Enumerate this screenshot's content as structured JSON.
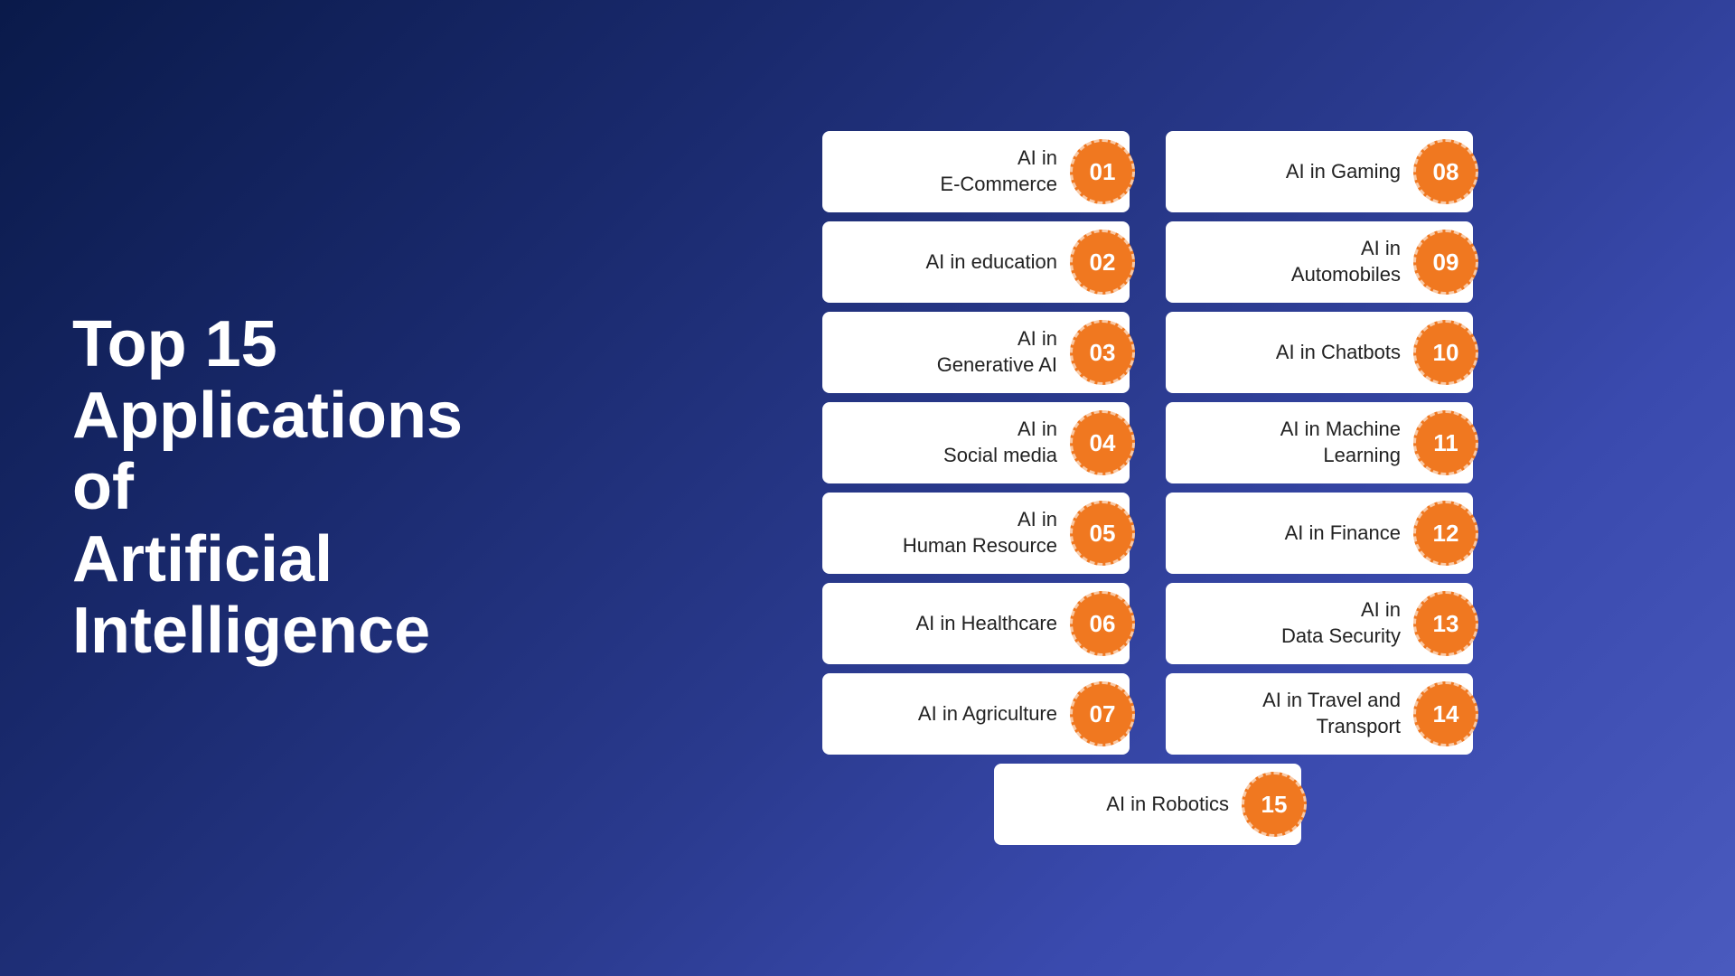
{
  "title": {
    "line1": "Top 15",
    "line2": "Applications of",
    "line3": "Artificial Intelligence"
  },
  "left_column": [
    {
      "label": "AI in\nE-Commerce",
      "number": "01"
    },
    {
      "label": "AI in education",
      "number": "02"
    },
    {
      "label": "AI in\nGenerative AI",
      "number": "03"
    },
    {
      "label": "AI in\nSocial media",
      "number": "04"
    },
    {
      "label": "AI in\nHuman Resource",
      "number": "05"
    },
    {
      "label": "AI in Healthcare",
      "number": "06"
    },
    {
      "label": "AI in Agriculture",
      "number": "07"
    }
  ],
  "right_column": [
    {
      "label": "AI in Gaming",
      "number": "08"
    },
    {
      "label": "AI in\nAutomobiles",
      "number": "09"
    },
    {
      "label": "AI in Chatbots",
      "number": "10"
    },
    {
      "label": "AI in Machine\nLearning",
      "number": "11"
    },
    {
      "label": "AI in Finance",
      "number": "12"
    },
    {
      "label": "AI in\nData Security",
      "number": "13"
    },
    {
      "label": "AI in Travel and\nTransport",
      "number": "14"
    }
  ],
  "bottom_item": {
    "label": "AI in Robotics",
    "number": "15"
  },
  "colors": {
    "orange": "#f07820",
    "bg_start": "#0a1a4a",
    "bg_end": "#4a5abe",
    "card_bg": "#ffffff",
    "text_dark": "#222222",
    "text_white": "#ffffff"
  }
}
